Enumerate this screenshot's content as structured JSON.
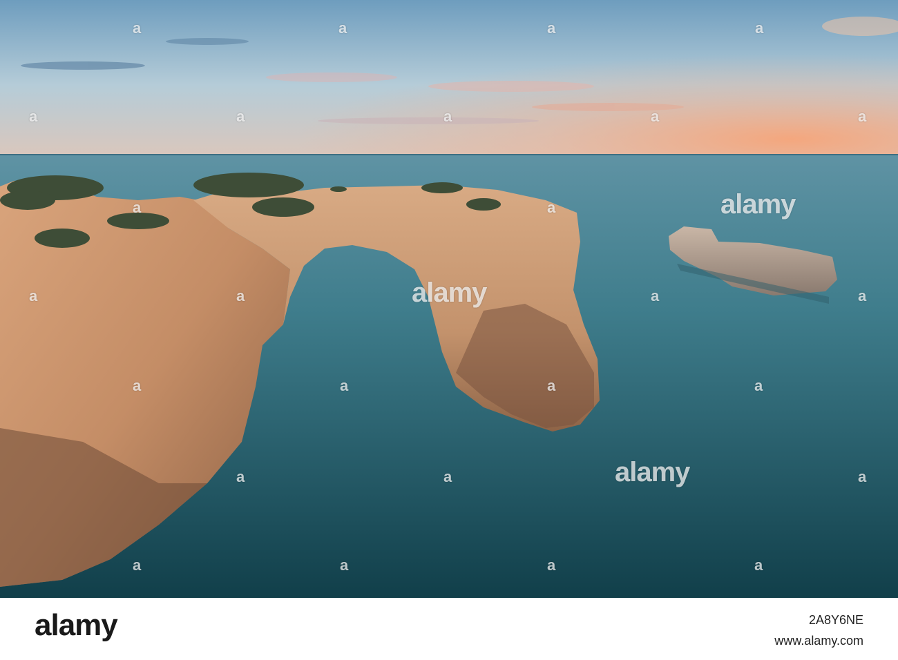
{
  "photo": {
    "subject": "sea-arch-at-sunset",
    "colors": {
      "sky_top": "#6f9fc0",
      "sky_mid": "#a9c4d4",
      "sky_glow": "#f2a27a",
      "sea_far": "#5b8fa0",
      "sea_near": "#134a55",
      "rock_light": "#d4a27a",
      "rock_dark": "#8a5e42",
      "bush": "#3d4c35"
    }
  },
  "watermark": {
    "word": "alamy",
    "small_letter": "a"
  },
  "footer": {
    "logo": "alamy",
    "image_id": "2A8Y6NE",
    "url": "www.alamy.com"
  }
}
